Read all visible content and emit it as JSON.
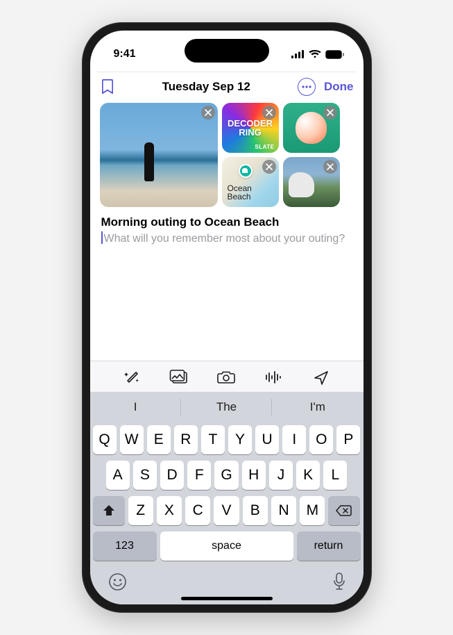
{
  "status": {
    "time": "9:41"
  },
  "header": {
    "title": "Tuesday Sep 12",
    "done_label": "Done"
  },
  "attachments": {
    "podcast_title": "DECODER RING",
    "podcast_publisher": "SLATE",
    "map_label": "Ocean\nBeach"
  },
  "entry": {
    "title": "Morning outing to Ocean Beach",
    "prompt_placeholder": "What will you remember most about your outing?"
  },
  "suggestions": [
    "I",
    "The",
    "I'm"
  ],
  "keyboard": {
    "row1": [
      "Q",
      "W",
      "E",
      "R",
      "T",
      "Y",
      "U",
      "I",
      "O",
      "P"
    ],
    "row2": [
      "A",
      "S",
      "D",
      "F",
      "G",
      "H",
      "J",
      "K",
      "L"
    ],
    "row3": [
      "Z",
      "X",
      "C",
      "V",
      "B",
      "N",
      "M"
    ],
    "numeric_label": "123",
    "space_label": "space",
    "return_label": "return"
  }
}
